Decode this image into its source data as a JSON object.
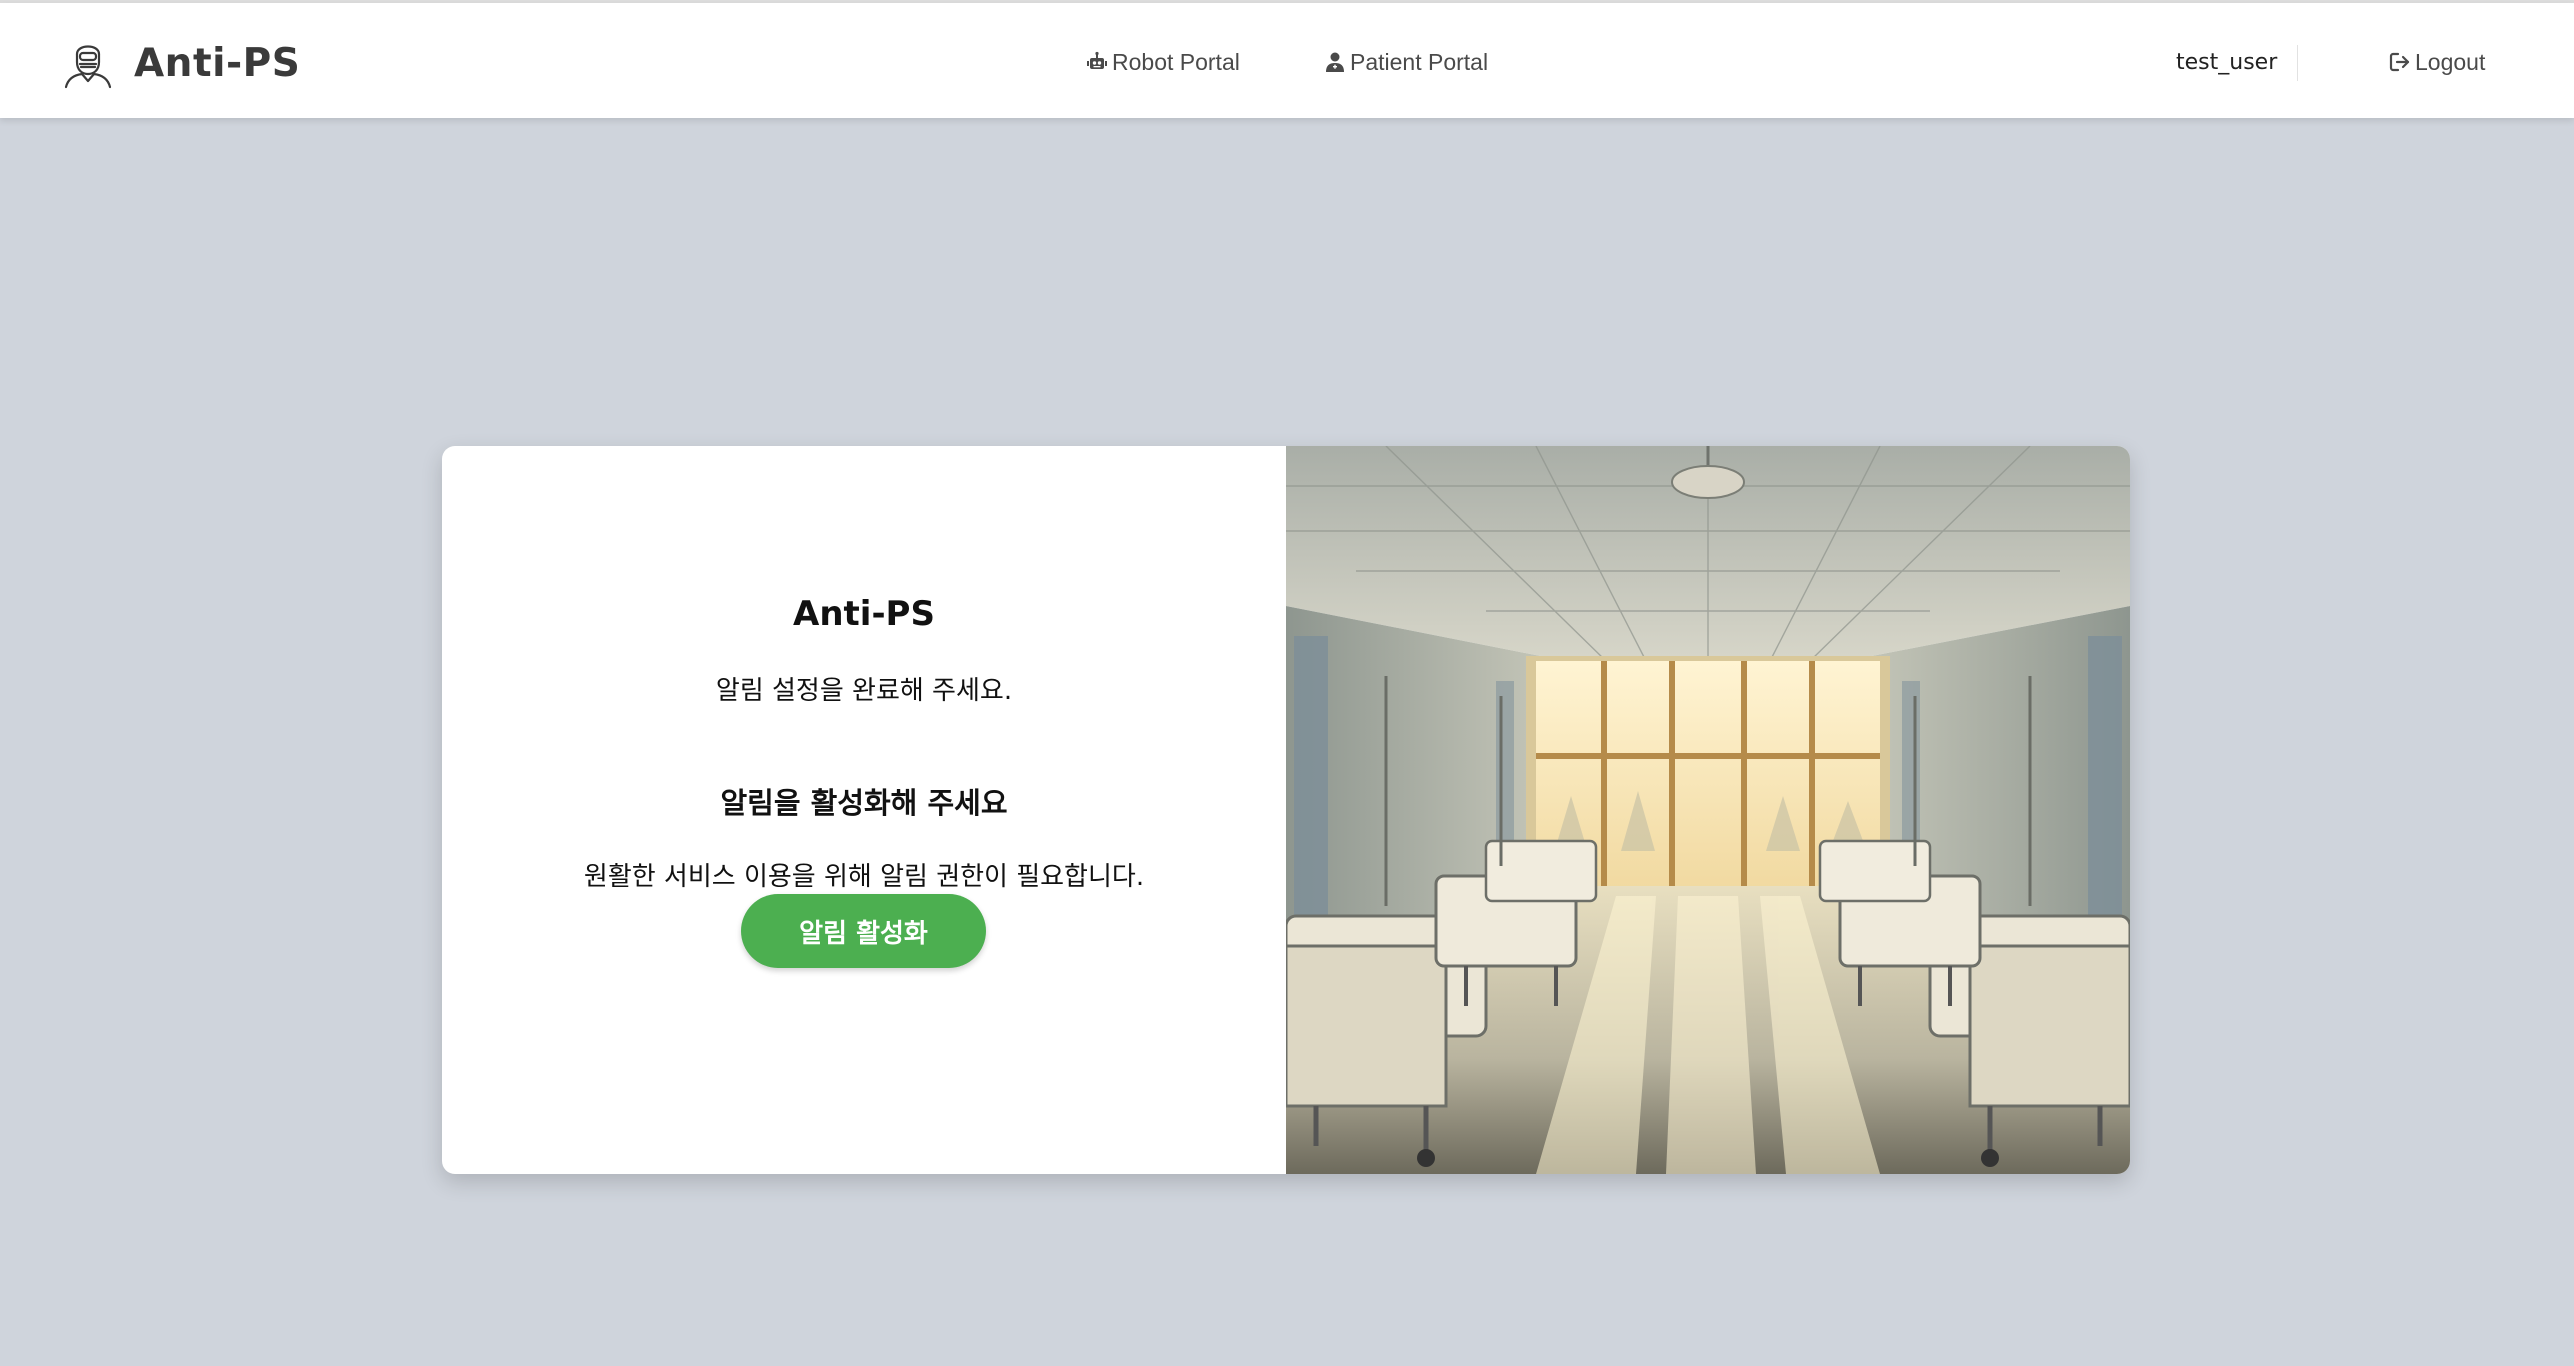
{
  "header": {
    "brand_name": "Anti-PS",
    "nav_items": [
      {
        "label": "Robot Portal",
        "icon": "robot-icon"
      },
      {
        "label": "Patient Portal",
        "icon": "patient-icon"
      }
    ],
    "username": "test_user",
    "logout_label": "Logout",
    "logout_icon": "logout-icon"
  },
  "card": {
    "title": "Anti-PS",
    "subtitle": "알림 설정을 완료해 주세요.",
    "heading": "알림을 활성화해 주세요",
    "description": "원활한 서비스 이용을 위해 알림 권한이 필요합니다.",
    "button_label": "알림 활성화",
    "image": "hospital-ward-illustration"
  },
  "colors": {
    "page_background": "#cfd4dc",
    "accent_green": "#4caf50",
    "navbar_background": "#ffffff"
  }
}
